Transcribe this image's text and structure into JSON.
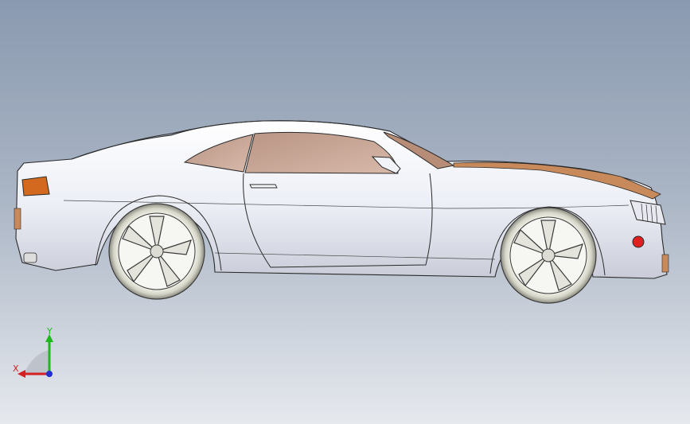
{
  "triad": {
    "x_label": "X",
    "y_label": "Y",
    "x_color": "#d42020",
    "y_color": "#1db81d",
    "z_color": "#2030d0"
  },
  "model": {
    "name": "car-side-view",
    "body_color": "#f4f5fa",
    "glass_color": "#c9a898",
    "accent_color": "#c88a5a",
    "tail_light_color": "#d2691e",
    "fog_light_color": "#e02020"
  }
}
